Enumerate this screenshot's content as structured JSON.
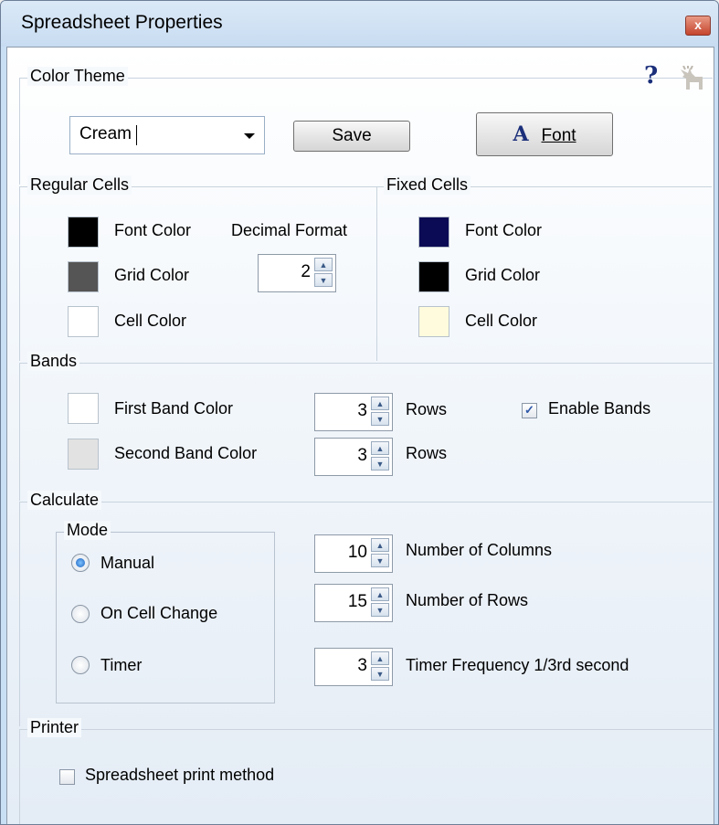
{
  "window": {
    "title": "Spreadsheet Properties",
    "close_glyph": "x"
  },
  "color_theme": {
    "legend": "Color Theme",
    "help_glyph": "?",
    "theme_value": "Cream",
    "save_label": "Save",
    "font_label": "Font",
    "font_icon_glyph": "A"
  },
  "regular_cells": {
    "legend": "Regular Cells",
    "font_color_label": "Font Color",
    "grid_color_label": "Grid Color",
    "cell_color_label": "Cell Color",
    "decimal_format_label": "Decimal Format",
    "decimal_format_value": "2",
    "colors": {
      "font": "#000000",
      "grid": "#555555",
      "cell": "#ffffff"
    }
  },
  "fixed_cells": {
    "legend": "Fixed Cells",
    "font_color_label": "Font Color",
    "grid_color_label": "Grid Color",
    "cell_color_label": "Cell Color",
    "colors": {
      "font": "#0b0b55",
      "grid": "#000000",
      "cell": "#fffbdc"
    }
  },
  "bands": {
    "legend": "Bands",
    "first_label": "First Band Color",
    "second_label": "Second Band Color",
    "first_rows": "3",
    "second_rows": "3",
    "rows_label": "Rows",
    "enable_label": "Enable Bands",
    "enable_checked": true,
    "colors": {
      "first": "#ffffff",
      "second": "#e2e2e2"
    }
  },
  "calculate": {
    "legend": "Calculate",
    "mode_legend": "Mode",
    "modes": {
      "manual": "Manual",
      "on_cell_change": "On Cell Change",
      "timer": "Timer"
    },
    "selected_mode": "Manual",
    "columns_value": "10",
    "columns_label": "Number of Columns",
    "rows_value": "15",
    "rows_label": "Number of Rows",
    "timer_value": "3",
    "timer_label": "Timer Frequency 1/3rd second"
  },
  "printer": {
    "legend": "Printer",
    "print_method_label": "Spreadsheet print method",
    "print_method_checked": false
  }
}
